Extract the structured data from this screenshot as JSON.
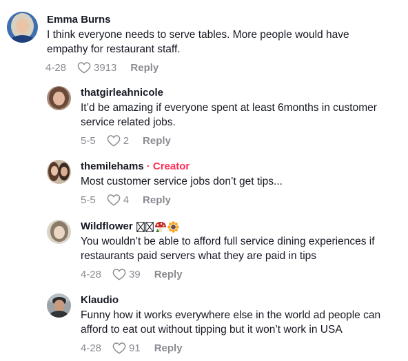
{
  "comments": [
    {
      "username": "Emma Burns",
      "text_lines": [
        "I think everyone needs to serve tables. More people would have",
        "empathy for restaurant staff."
      ],
      "date": "4-28",
      "likes": "3913",
      "reply_label": "Reply"
    },
    {
      "username": "thatgirleahnicole",
      "text_lines": [
        "It’d be amazing if everyone spent at least 6months in customer",
        "service related jobs."
      ],
      "date": "5-5",
      "likes": "2",
      "reply_label": "Reply"
    },
    {
      "username": "themilehams",
      "badge": "· Creator",
      "text_lines": [
        "Most customer service jobs don’t get tips..."
      ],
      "date": "5-5",
      "likes": "4",
      "reply_label": "Reply"
    },
    {
      "username": "Wildflower",
      "text_lines": [
        "You wouldn’t be able to afford full service dining experiences if",
        "restaurants paid servers what they are paid in tips"
      ],
      "date": "4-28",
      "likes": "39",
      "reply_label": "Reply"
    },
    {
      "username": "Klaudio",
      "text_lines": [
        "Funny how it works everywhere else in the world ad people can",
        "afford to eat out without tipping but it won’t work in USA"
      ],
      "date": "4-28",
      "likes": "91",
      "reply_label": "Reply"
    }
  ],
  "colors": {
    "text": "#161823",
    "meta": "#8a8b91",
    "creator": "#fe2c55"
  }
}
